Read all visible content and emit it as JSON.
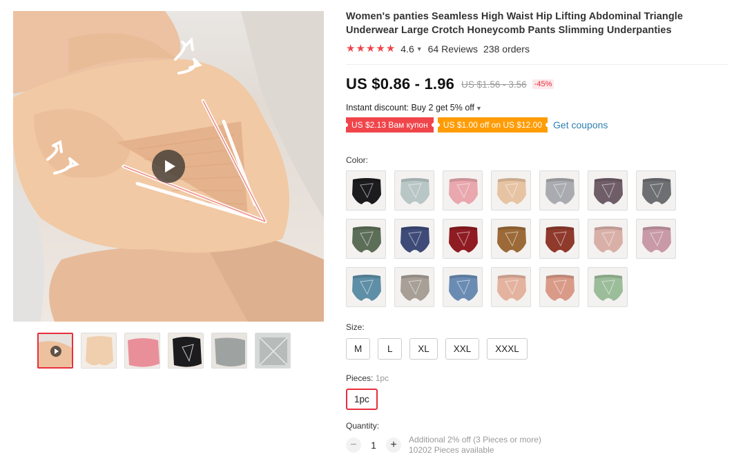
{
  "product": {
    "title": "Women's panties Seamless High Waist Hip Lifting Abdominal Triangle Underwear Large Crotch Honeycomb Pants Slimming Underpanties",
    "rating": "4.6",
    "reviews": "64 Reviews",
    "orders": "238 orders",
    "stars_filled": 5
  },
  "price": {
    "current": "US $0.86 - 1.96",
    "original": "US $1.56 - 3.56",
    "discount": "-45%"
  },
  "promo": {
    "instant_discount": "Instant discount: Buy 2 get 5% off",
    "coupon_store": "US $2.13 Вам купон",
    "coupon_select": "US $1.00 off on US $12.00",
    "get_coupons": "Get coupons"
  },
  "color": {
    "label": "Color:",
    "swatch_colors": [
      "#1c1c1e",
      "#b9c6c6",
      "#e9a7ae",
      "#e6c3a2",
      "#a9abb0",
      "#6f5d68",
      "#6e6f72",
      "#5d6e58",
      "#3e4b78",
      "#8e1c22",
      "#9c6a38",
      "#8f3a2c",
      "#d9b0a8",
      "#c89aa6",
      "#5e8fa6",
      "#a89f97",
      "#6a8cb3",
      "#e4b39f",
      "#d99a88",
      "#9cbd9a"
    ]
  },
  "size": {
    "label": "Size:",
    "options": [
      "M",
      "L",
      "XL",
      "XXL",
      "XXXL"
    ]
  },
  "pieces": {
    "label": "Pieces:",
    "selected": "1pc",
    "option": "1pc"
  },
  "quantity": {
    "label": "Quantity:",
    "value": "1",
    "minus": "−",
    "plus": "+",
    "note_discount": "Additional 2% off (3 Pieces or more)",
    "note_available": "10202 Pieces available"
  },
  "gallery": {
    "thumb_colors": [
      "#e8c9a8",
      "#f0d4b8",
      "#e8919a",
      "#1c1c1e",
      "#9ea3a2",
      "#b7bcbb"
    ]
  }
}
